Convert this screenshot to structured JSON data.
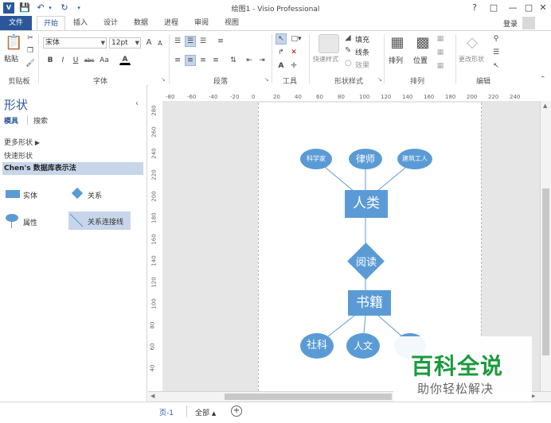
{
  "window": {
    "title": "绘图1 - Visio Professional",
    "help": "?",
    "login": "登录"
  },
  "tabs": [
    "文件",
    "开始",
    "插入",
    "设计",
    "数据",
    "进程",
    "审阅",
    "视图"
  ],
  "ribbon": {
    "clipboard": {
      "paste": "粘贴",
      "label": "剪贴板"
    },
    "font": {
      "name": "宋体",
      "size": "12pt",
      "label": "字体"
    },
    "paragraph": {
      "label": "段落"
    },
    "tools": {
      "label": "工具"
    },
    "shape_style": {
      "quick_styles": "快速样式",
      "fill": "填充",
      "line": "线条",
      "effects": "效果",
      "label": "形状样式"
    },
    "arrange": {
      "arrange": "排列",
      "position": "位置",
      "label": "排列"
    },
    "edit": {
      "change_shape": "更改形状",
      "label": "编辑"
    }
  },
  "shapes_pane": {
    "title": "形状",
    "tab_stencils": "模具",
    "tab_search": "搜索",
    "more_shapes": "更多形状",
    "quick_shapes": "快速形状",
    "stencil": "Chen's 数据库表示法",
    "masters": {
      "entity": "实体",
      "relationship": "关系",
      "attribute": "属性",
      "connector": "关系连接线"
    }
  },
  "ruler_top": [
    "-80",
    "-60",
    "-40",
    "-20",
    "0",
    "20",
    "40",
    "60",
    "80",
    "100",
    "120",
    "140",
    "160",
    "180",
    "200",
    "220",
    "240"
  ],
  "ruler_left": [
    "280",
    "260",
    "240",
    "220",
    "200",
    "180",
    "160",
    "140",
    "120",
    "100",
    "80",
    "60",
    "40"
  ],
  "diagram": {
    "attr_scientist": "科学家",
    "attr_lawyer": "律师",
    "attr_architect": "建筑工人",
    "entity_human": "人类",
    "rel_read": "阅读",
    "entity_book": "书籍",
    "attr_social": "社科",
    "attr_humanities": "人文",
    "color": "#5b9bd5"
  },
  "status": {
    "page": "页-1",
    "all": "全部"
  },
  "watermark": {
    "title": "百科全说",
    "subtitle": "助你轻松解决"
  }
}
